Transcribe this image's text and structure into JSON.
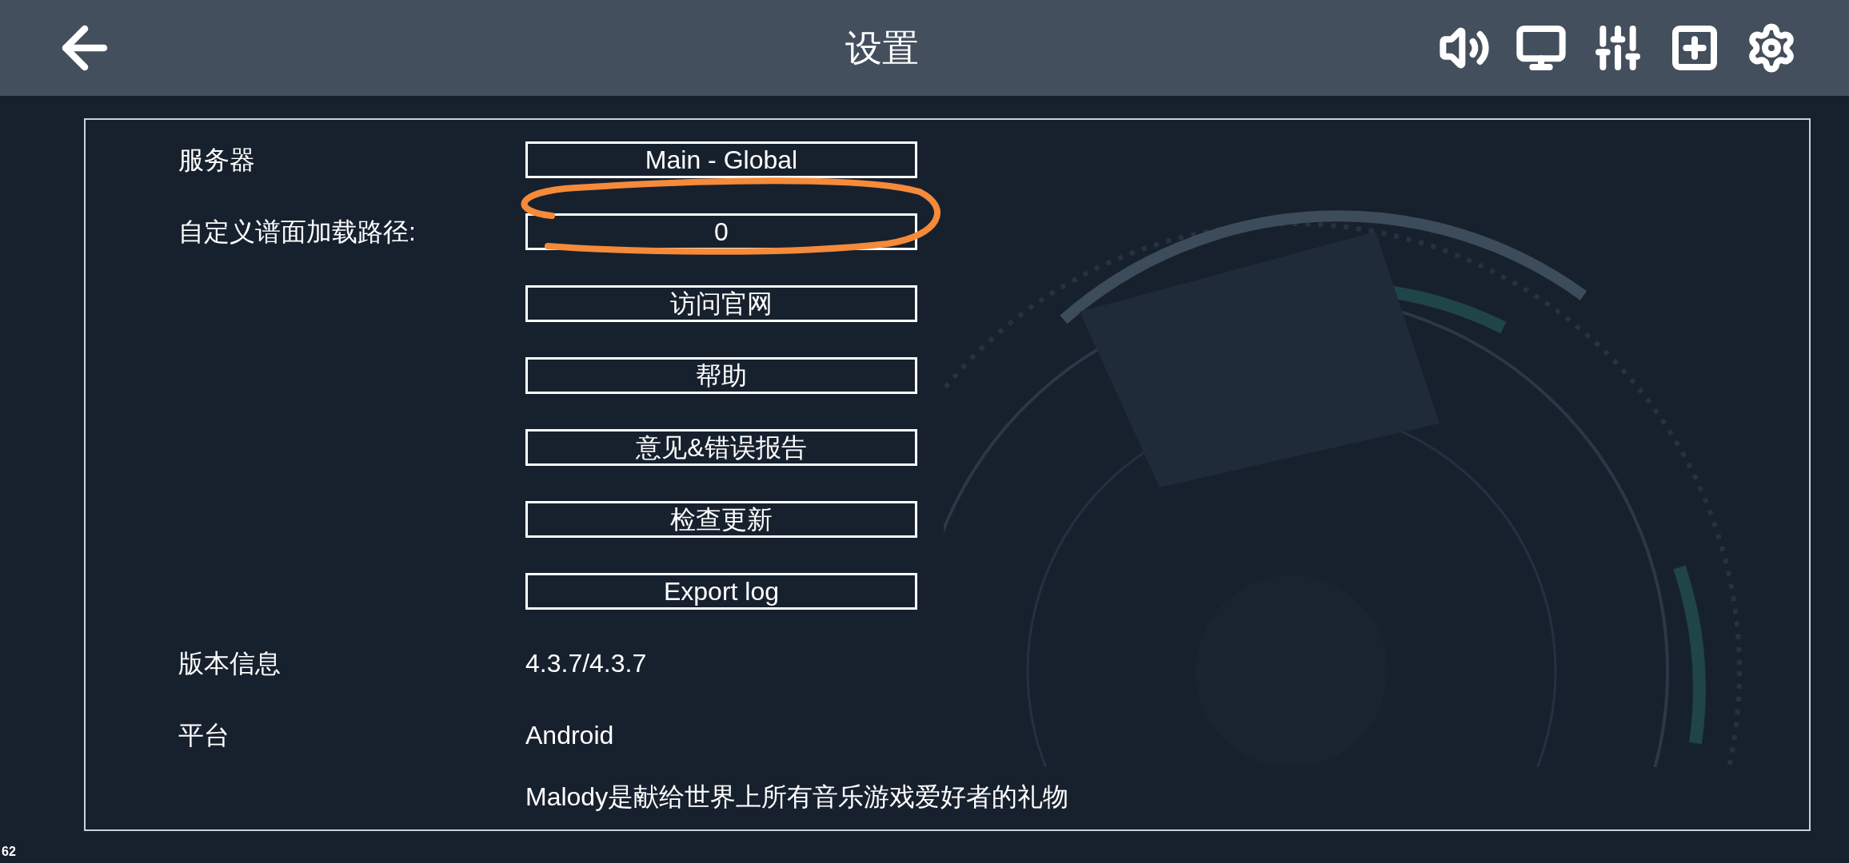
{
  "header": {
    "title": "设置"
  },
  "settings": [
    {
      "kind": "button",
      "label": "服务器",
      "value": "Main - Global"
    },
    {
      "kind": "button",
      "label": "自定义谱面加载路径:",
      "value": "0"
    },
    {
      "kind": "button",
      "value": "访问官网"
    },
    {
      "kind": "button",
      "value": "帮助"
    },
    {
      "kind": "button",
      "value": "意见&错误报告"
    },
    {
      "kind": "button",
      "value": "检查更新"
    },
    {
      "kind": "button",
      "value": "Export log"
    },
    {
      "kind": "info",
      "label": "版本信息",
      "value": "4.3.7/4.3.7"
    },
    {
      "kind": "info",
      "label": "平台",
      "value": "Android"
    }
  ],
  "footer_text": "Malody是献给世界上所有音乐游戏爱好者的礼物",
  "fps": "62"
}
